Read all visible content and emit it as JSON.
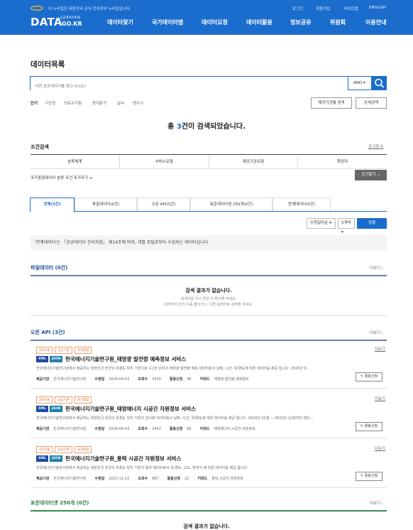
{
  "header": {
    "gov_notice": "이 누리집은 대한민국 공식 전자정부 누리집입니다.",
    "util": [
      "로그인",
      "회원가입",
      "사이트맵",
      "ENGLISH"
    ],
    "logo_main": "DATA",
    "logo_sub": "공공데이터포털",
    "logo_kr": ".GO.KR",
    "nav": [
      "데이터찾기",
      "국가데이터맵",
      "데이터요청",
      "데이터활용",
      "정보공유",
      "위원회",
      "이용안내"
    ]
  },
  "page_title": "데이터목록",
  "search": {
    "placeholder": "어떤 공공데이터를 찾으시나요?",
    "operator": "AND"
  },
  "popular": [
    "인기",
    "기상청",
    "의료수거함",
    "동대문구",
    "날씨",
    "명주시"
  ],
  "buttons": {
    "provider_search": "제공기관별 검색",
    "detail_search": "상세검색"
  },
  "total": {
    "prefix": "총 ",
    "count": "3",
    "suffix": "건이 검색되었습니다."
  },
  "conditions": {
    "title": "조건검색",
    "reset": "조기화",
    "columns": [
      "분류체계",
      "서비스유형",
      "제공기관유형",
      "확장자"
    ],
    "add": "국가중점데이터 분류 조건 추가하기 +",
    "open": "조건열기"
  },
  "tabs": [
    "전체(3건)",
    "파일데이터(0건)",
    "오픈 API(3건)",
    "표준데이터셋 250개(0건)",
    "연계데이터(0건)"
  ],
  "sort": {
    "order": "수정일자순",
    "count": "5개씩",
    "apply": "정렬"
  },
  "notice": "'연계데이터'는 「공공데이터 관리지침」 제14조에 따라, 개별 포털로부터 수집되는 데이터입니다.",
  "file_section": {
    "title": "파일데이터 (0건)",
    "more": "더보기",
    "empty_title": "검색 결과가 없습니다.",
    "empty_desc1": "검색어를 다시 한번 더 확인해 주세요.",
    "empty_desc2": "검색어의 단어 수를 줄이거나, 다른 검색어로 검색해 주세요."
  },
  "api_section": {
    "title": "오픈 API (3건)",
    "more": "더보기"
  },
  "items": [
    {
      "badges": [
        "3차기술",
        "공공기관",
        "국가중점"
      ],
      "formats": [
        "XML",
        "JSON"
      ],
      "title": "한국에너지기술연구원_태양광 발전량 예측정보 서비스",
      "desc": "한국에너지기술연구원에서 제공하는 대한민국 전국의 위경도 위치 기반으로 1시간 단위의 태양광 발전량 예측 데이터로서 날짜, 시간, 위/경도에 따른 데이터를 제공 합니다. 2020년 6...",
      "provider_label": "제공기관",
      "provider": "한국에너지기술연구원",
      "updated_label": "수정일",
      "updated": "2024-04-03",
      "views_label": "조회수",
      "views": "2930",
      "apply_count_label": "활용신청",
      "apply_count": "98",
      "kw_label": "키워드",
      "keywords": "태양광,발전량,예측정보",
      "more": "더보기",
      "apply": "활용신청"
    },
    {
      "badges": [
        "3차기술",
        "공공기관",
        "국가중점"
      ],
      "formats": [
        "XML",
        "JSON"
      ],
      "title": "한국에너지기술연구원_태양에너지 시공간 자원정보 서비스",
      "desc": "한국에너지기술연구원에서 제공하는 대한민국 전국의 위경도 위치 기반의 일사량 데이터로서 날짜, 시간, 위/경도에 따른 데이터를 제공 합니다. 2020년 01월 ~ 2022년 12월까지 데이...",
      "provider_label": "제공기관",
      "provider": "한국에너지기술연구원",
      "updated_label": "수정일",
      "updated": "2024-04-03",
      "views_label": "조회수",
      "views": "2443",
      "apply_count_label": "활용신청",
      "apply_count": "66",
      "kw_label": "키워드",
      "keywords": "태양에너지,시공간,자원정보",
      "more": "더보기",
      "apply": "활용신청"
    },
    {
      "badges": [
        "3차기술",
        "공공기관",
        "국가중점"
      ],
      "formats": [
        "XML",
        "JSON"
      ],
      "title": "한국에너지기술연구원_풍력 시공간 자원정보 서비스",
      "desc": "한국에너지기술연구원에서 제공하는 대한민국 전국의 위경도 위치 기반의 풍력 데이터로서 위/경도, 고도, 방위각 에 따른 데이터를 제공 합니다.",
      "provider_label": "제공기관",
      "provider": "한국에너지기술연구원",
      "updated_label": "수정일",
      "updated": "2023-11-22",
      "views_label": "조회수",
      "views": "887",
      "apply_count_label": "활용신청",
      "apply_count": "22",
      "kw_label": "키워드",
      "keywords": "풍력,시공간,자원정보",
      "more": "더보기",
      "apply": "활용신청"
    }
  ],
  "std_section": {
    "title": "표준데이터셋 250개 (0건)",
    "more": "더보기",
    "empty_title": "검색 결과가 없습니다."
  }
}
